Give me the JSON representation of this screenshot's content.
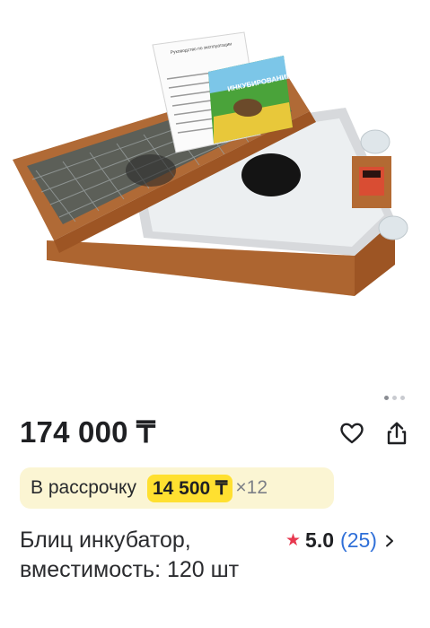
{
  "gallery": {
    "image_alt": "incubator",
    "booklet_title": "ИНКУБИРОВАНИЕ",
    "doc_title": "Руководство по эксплуатации",
    "pages": 3,
    "active_page": 1
  },
  "product": {
    "price": "174 000 ₸",
    "installment": {
      "label": "В рассрочку",
      "amount": "14 500 ₸",
      "multiplier": "×12"
    },
    "title": "Блиц инкубатор, вместимость: 120 шт",
    "rating": {
      "score": "5.0",
      "reviews": "(25)"
    }
  },
  "colors": {
    "price_text": "#1f2023",
    "installment_bg": "#fbf5d3",
    "installment_highlight": "#ffe030",
    "star": "#e7384f",
    "reviews_link": "#2f6fd8"
  },
  "icons": {
    "favorite": "heart-icon",
    "share": "share-icon",
    "rating": "star-icon",
    "more": "chevron-right-icon"
  }
}
